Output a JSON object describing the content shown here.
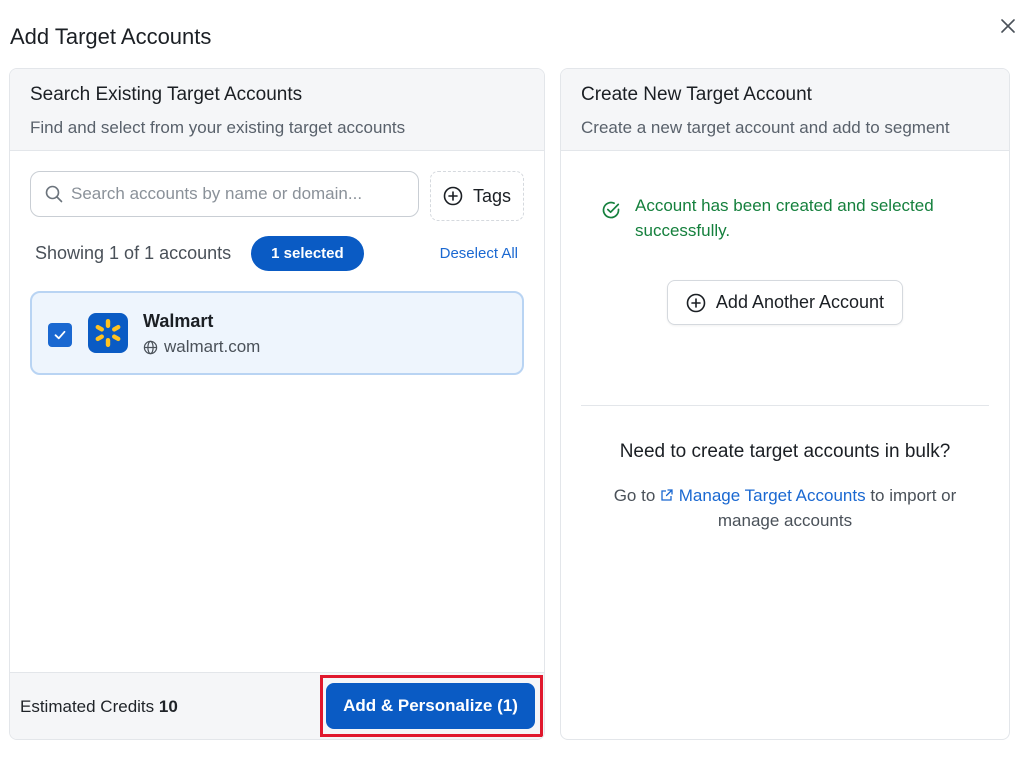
{
  "modal": {
    "title": "Add Target Accounts",
    "close_icon": "close-icon"
  },
  "left_panel": {
    "title": "Search Existing Target Accounts",
    "subtitle": "Find and select from your existing target accounts",
    "search": {
      "placeholder": "Search accounts by name or domain...",
      "value": ""
    },
    "tags_label": "Tags",
    "showing_text": "Showing 1 of 1 accounts",
    "selected_badge": "1 selected",
    "deselect_label": "Deselect All",
    "accounts": [
      {
        "name": "Walmart",
        "domain": "walmart.com",
        "checked": true,
        "logo_icon": "walmart-spark-icon"
      }
    ],
    "footer": {
      "credits_label": "Estimated Credits",
      "credits_value": "10",
      "primary_button": "Add & Personalize (1)"
    }
  },
  "right_panel": {
    "title": "Create New Target Account",
    "subtitle": "Create a new target account and add to segment",
    "success_message": "Account has been created and selected successfully.",
    "add_another_label": "Add Another Account",
    "bulk_title": "Need to create target accounts in bulk?",
    "bulk_prefix": "Go to",
    "bulk_link": "Manage Target Accounts",
    "bulk_suffix": "to import or manage accounts"
  },
  "colors": {
    "primary": "#0a5bc4",
    "link": "#1a68d1",
    "success": "#15803d",
    "highlight": "#e0182d",
    "walmart_yellow": "#ffc220"
  }
}
